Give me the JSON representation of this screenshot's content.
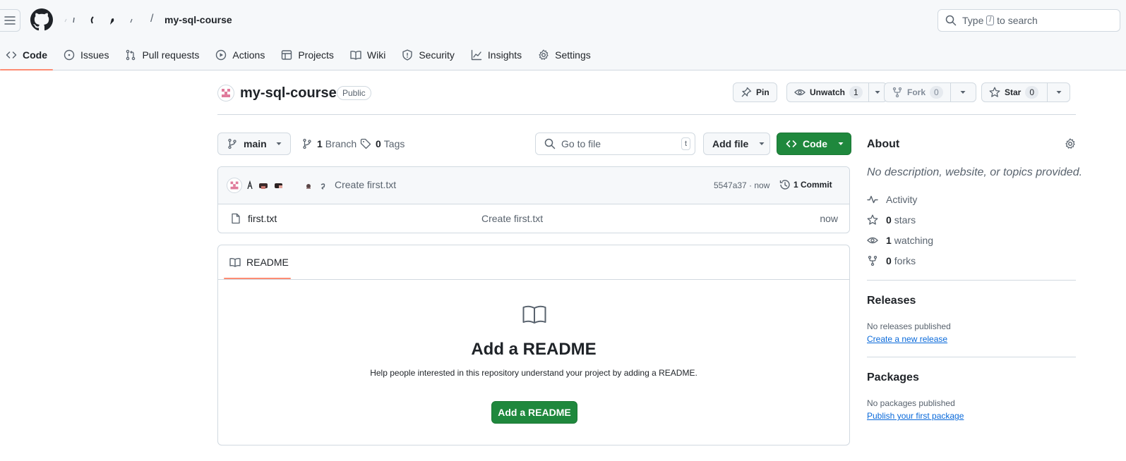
{
  "header": {
    "repo_name": "my-sql-course",
    "separator": "/",
    "search_prefix": "Type",
    "search_key": "/",
    "search_suffix": "to search"
  },
  "tabs": [
    {
      "label": "Code",
      "icon": "code-icon",
      "active": true
    },
    {
      "label": "Issues",
      "icon": "issue-icon"
    },
    {
      "label": "Pull requests",
      "icon": "pull-request-icon"
    },
    {
      "label": "Actions",
      "icon": "play-icon"
    },
    {
      "label": "Projects",
      "icon": "table-icon"
    },
    {
      "label": "Wiki",
      "icon": "book-icon"
    },
    {
      "label": "Security",
      "icon": "shield-icon"
    },
    {
      "label": "Insights",
      "icon": "graph-icon"
    },
    {
      "label": "Settings",
      "icon": "gear-icon"
    }
  ],
  "repo": {
    "title": "my-sql-course",
    "visibility": "Public",
    "pin_label": "Pin",
    "unwatch_label": "Unwatch",
    "watch_count": "1",
    "fork_label": "Fork",
    "fork_count": "0",
    "star_label": "Star",
    "star_count": "0"
  },
  "toolbar": {
    "branch": "main",
    "branch_count": "1",
    "branch_label": "Branch",
    "tag_count": "0",
    "tag_label": "Tags",
    "goto_placeholder": "Go to file",
    "goto_key": "t",
    "add_file_label": "Add file",
    "code_label": "Code"
  },
  "commit": {
    "message": "Create first.txt",
    "hash_time": "5547a37 · now",
    "commits_label": "1 Commit"
  },
  "files": [
    {
      "name": "first.txt",
      "message": "Create first.txt",
      "time": "now"
    }
  ],
  "readme": {
    "tab_label": "README",
    "heading": "Add a README",
    "description": "Help people interested in this repository understand your project by adding a README.",
    "button_label": "Add a README"
  },
  "sidebar": {
    "about_title": "About",
    "about_desc": "No description, website, or topics provided.",
    "activity_label": "Activity",
    "stars_count": "0",
    "stars_label": "stars",
    "watching_count": "1",
    "watching_label": "watching",
    "forks_count": "0",
    "forks_label": "forks",
    "releases_title": "Releases",
    "releases_none": "No releases published",
    "releases_link": "Create a new release",
    "packages_title": "Packages",
    "packages_none": "No packages published",
    "packages_link": "Publish your first package"
  },
  "colors": {
    "accent_green": "#1f883d",
    "tab_underline": "#fd8c73",
    "link_blue": "#0969da"
  }
}
